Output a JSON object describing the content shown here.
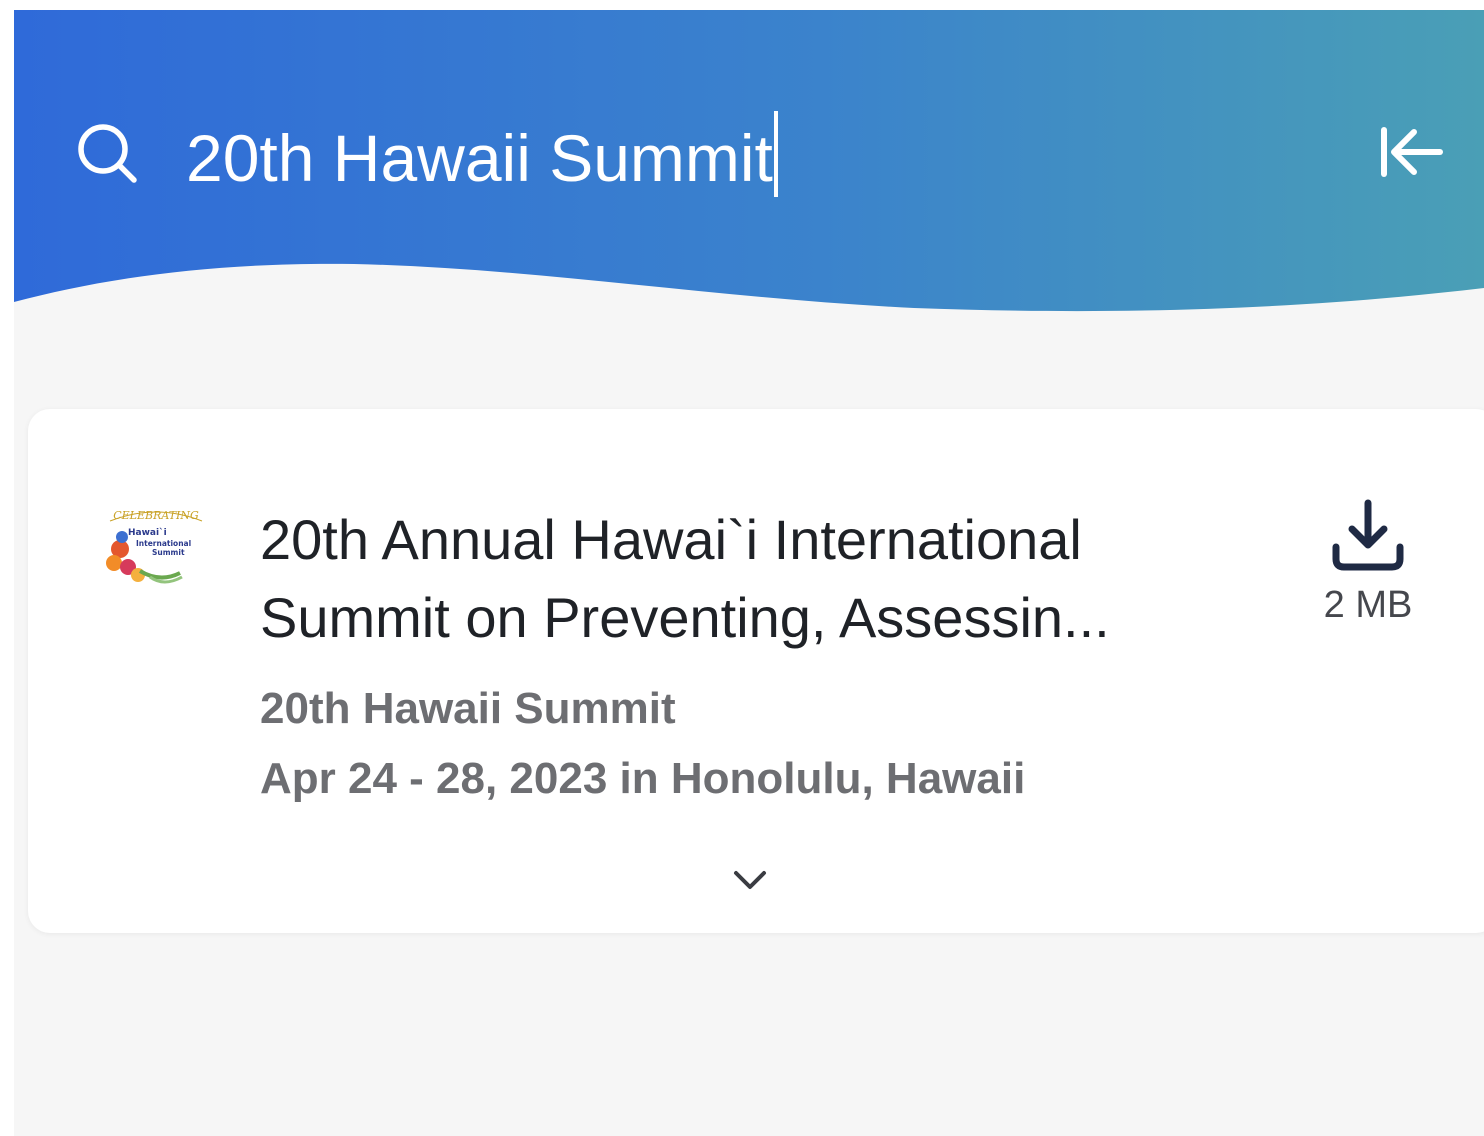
{
  "colors": {
    "header_gradient_start": "#2f6ad9",
    "header_gradient_end": "#4a9fb6",
    "background": "#f6f6f6",
    "card": "#ffffff",
    "title_text": "#1f2227",
    "secondary_text": "#6d6e72"
  },
  "search": {
    "icon": "search-icon",
    "value": "20th Hawaii Summit",
    "collapse_icon": "collapse-left-arrow-icon"
  },
  "result": {
    "logo_text_lines": [
      "CELEBRATING",
      "Hawai`i",
      "International",
      "Summit"
    ],
    "title_line1": "20th Annual Hawai`i International",
    "title_line2": "Summit on Preventing, Assessin...",
    "subtitle": "20th Hawaii Summit",
    "date_location": "Apr 24 - 28, 2023 in Honolulu, Hawaii",
    "download_icon": "download-icon",
    "download_size": "2 MB",
    "expand_icon": "chevron-down-icon"
  }
}
